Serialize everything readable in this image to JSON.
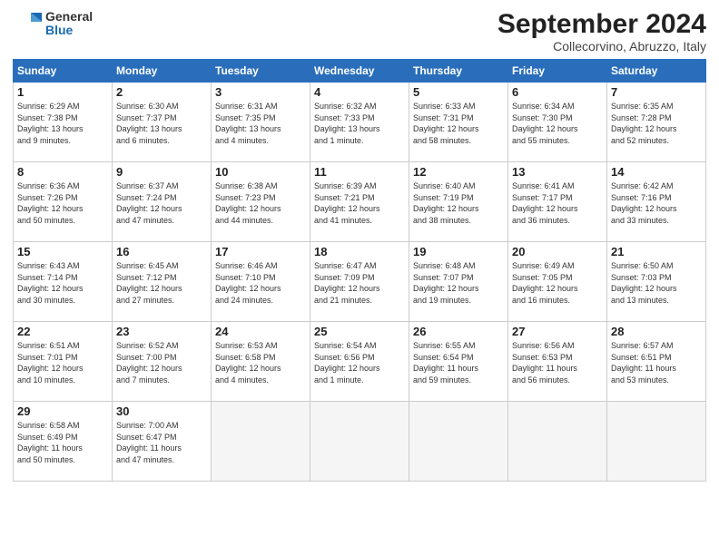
{
  "header": {
    "logo_general": "General",
    "logo_blue": "Blue",
    "month_year": "September 2024",
    "location": "Collecorvino, Abruzzo, Italy"
  },
  "columns": [
    "Sunday",
    "Monday",
    "Tuesday",
    "Wednesday",
    "Thursday",
    "Friday",
    "Saturday"
  ],
  "weeks": [
    [
      {
        "day": 1,
        "sunrise": "6:29 AM",
        "sunset": "7:38 PM",
        "daylight": "13 hours and 9 minutes."
      },
      {
        "day": 2,
        "sunrise": "6:30 AM",
        "sunset": "7:37 PM",
        "daylight": "13 hours and 6 minutes."
      },
      {
        "day": 3,
        "sunrise": "6:31 AM",
        "sunset": "7:35 PM",
        "daylight": "13 hours and 4 minutes."
      },
      {
        "day": 4,
        "sunrise": "6:32 AM",
        "sunset": "7:33 PM",
        "daylight": "13 hours and 1 minute."
      },
      {
        "day": 5,
        "sunrise": "6:33 AM",
        "sunset": "7:31 PM",
        "daylight": "12 hours and 58 minutes."
      },
      {
        "day": 6,
        "sunrise": "6:34 AM",
        "sunset": "7:30 PM",
        "daylight": "12 hours and 55 minutes."
      },
      {
        "day": 7,
        "sunrise": "6:35 AM",
        "sunset": "7:28 PM",
        "daylight": "12 hours and 52 minutes."
      }
    ],
    [
      {
        "day": 8,
        "sunrise": "6:36 AM",
        "sunset": "7:26 PM",
        "daylight": "12 hours and 50 minutes."
      },
      {
        "day": 9,
        "sunrise": "6:37 AM",
        "sunset": "7:24 PM",
        "daylight": "12 hours and 47 minutes."
      },
      {
        "day": 10,
        "sunrise": "6:38 AM",
        "sunset": "7:23 PM",
        "daylight": "12 hours and 44 minutes."
      },
      {
        "day": 11,
        "sunrise": "6:39 AM",
        "sunset": "7:21 PM",
        "daylight": "12 hours and 41 minutes."
      },
      {
        "day": 12,
        "sunrise": "6:40 AM",
        "sunset": "7:19 PM",
        "daylight": "12 hours and 38 minutes."
      },
      {
        "day": 13,
        "sunrise": "6:41 AM",
        "sunset": "7:17 PM",
        "daylight": "12 hours and 36 minutes."
      },
      {
        "day": 14,
        "sunrise": "6:42 AM",
        "sunset": "7:16 PM",
        "daylight": "12 hours and 33 minutes."
      }
    ],
    [
      {
        "day": 15,
        "sunrise": "6:43 AM",
        "sunset": "7:14 PM",
        "daylight": "12 hours and 30 minutes."
      },
      {
        "day": 16,
        "sunrise": "6:45 AM",
        "sunset": "7:12 PM",
        "daylight": "12 hours and 27 minutes."
      },
      {
        "day": 17,
        "sunrise": "6:46 AM",
        "sunset": "7:10 PM",
        "daylight": "12 hours and 24 minutes."
      },
      {
        "day": 18,
        "sunrise": "6:47 AM",
        "sunset": "7:09 PM",
        "daylight": "12 hours and 21 minutes."
      },
      {
        "day": 19,
        "sunrise": "6:48 AM",
        "sunset": "7:07 PM",
        "daylight": "12 hours and 19 minutes."
      },
      {
        "day": 20,
        "sunrise": "6:49 AM",
        "sunset": "7:05 PM",
        "daylight": "12 hours and 16 minutes."
      },
      {
        "day": 21,
        "sunrise": "6:50 AM",
        "sunset": "7:03 PM",
        "daylight": "12 hours and 13 minutes."
      }
    ],
    [
      {
        "day": 22,
        "sunrise": "6:51 AM",
        "sunset": "7:01 PM",
        "daylight": "12 hours and 10 minutes."
      },
      {
        "day": 23,
        "sunrise": "6:52 AM",
        "sunset": "7:00 PM",
        "daylight": "12 hours and 7 minutes."
      },
      {
        "day": 24,
        "sunrise": "6:53 AM",
        "sunset": "6:58 PM",
        "daylight": "12 hours and 4 minutes."
      },
      {
        "day": 25,
        "sunrise": "6:54 AM",
        "sunset": "6:56 PM",
        "daylight": "12 hours and 1 minute."
      },
      {
        "day": 26,
        "sunrise": "6:55 AM",
        "sunset": "6:54 PM",
        "daylight": "11 hours and 59 minutes."
      },
      {
        "day": 27,
        "sunrise": "6:56 AM",
        "sunset": "6:53 PM",
        "daylight": "11 hours and 56 minutes."
      },
      {
        "day": 28,
        "sunrise": "6:57 AM",
        "sunset": "6:51 PM",
        "daylight": "11 hours and 53 minutes."
      }
    ],
    [
      {
        "day": 29,
        "sunrise": "6:58 AM",
        "sunset": "6:49 PM",
        "daylight": "11 hours and 50 minutes."
      },
      {
        "day": 30,
        "sunrise": "7:00 AM",
        "sunset": "6:47 PM",
        "daylight": "11 hours and 47 minutes."
      },
      null,
      null,
      null,
      null,
      null
    ]
  ]
}
